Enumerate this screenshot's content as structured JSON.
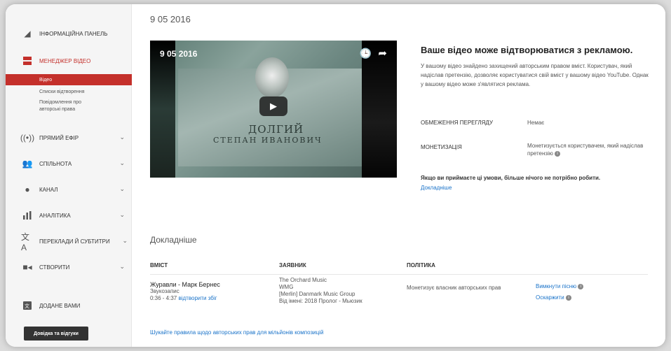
{
  "sidebar": {
    "items": [
      {
        "label": "ІНФОРМАЦІЙНА ПАНЕЛЬ",
        "icon": "dashboard-icon"
      },
      {
        "label": "МЕНЕДЖЕР ВІДЕО",
        "icon": "video-manager-icon"
      },
      {
        "label": "ПРЯМИЙ ЕФІР",
        "icon": "live-icon"
      },
      {
        "label": "СПІЛЬНОТА",
        "icon": "community-icon"
      },
      {
        "label": "КАНАЛ",
        "icon": "channel-icon"
      },
      {
        "label": "АНАЛІТИКА",
        "icon": "analytics-icon"
      },
      {
        "label": "ПЕРЕКЛАДИ Й СУБТИТРИ",
        "icon": "translate-icon"
      },
      {
        "label": "СТВОРИТИ",
        "icon": "create-icon"
      },
      {
        "label": "ДОДАНЕ ВАМИ",
        "icon": "added-by-you-icon"
      }
    ],
    "subitems": [
      "Відео",
      "Списки відтворення",
      "Повідомлення про",
      "авторські права"
    ],
    "help_button": "Довідка та відгуки"
  },
  "main": {
    "top_date": "9 05 2016",
    "video": {
      "title": "9 05 2016",
      "plate_line1": "ДОЛГИЙ",
      "plate_line2": "СТЕПАН ИВАНОВИЧ"
    },
    "ad_title": "Ваше відео може відтворюватися з рекламою.",
    "ad_desc": "У вашому відео знайдено захищений авторським правом вміст. Користувач, який надіслав претензію, дозволяє користуватися свій вміст у вашому відео YouTube. Однак у вашому відео може з'являтися реклама.",
    "restriction_label": "ОБМЕЖЕННЯ ПЕРЕГЛЯДУ",
    "restriction_value": "Немає",
    "monetization_label": "МОНЕТИЗАЦІЯ",
    "monetization_value": "Монетизується користувачем, який надіслав претензію",
    "accept_text": "Якщо ви приймаєте ці умови, більше нічого не потрібно робити.",
    "more_link": "Докладніше",
    "section_title": "Докладніше",
    "table": {
      "headers": [
        "ВМІСТ",
        "ЗАЯВНИК",
        "ПОЛІТИКА"
      ],
      "row": {
        "song": "Журавли - Марк Бернес",
        "type": "Звукозапис",
        "time": "0:36 - 4:37",
        "match_link": "відтворити збіг",
        "claimant_1": "The Orchard Music",
        "claimant_2": "WMG",
        "claimant_3": "[Merlin] Danmark Music Group",
        "claimant_4": "Від імені: 2018 Пролог - Мьюзик",
        "policy": "Монетизує власник авторських прав",
        "action_1": "Вимкнути пісню",
        "action_2": "Оскаржити"
      }
    },
    "footer_link": "Шукайте правила щодо авторських прав для мільйонів композицій"
  }
}
